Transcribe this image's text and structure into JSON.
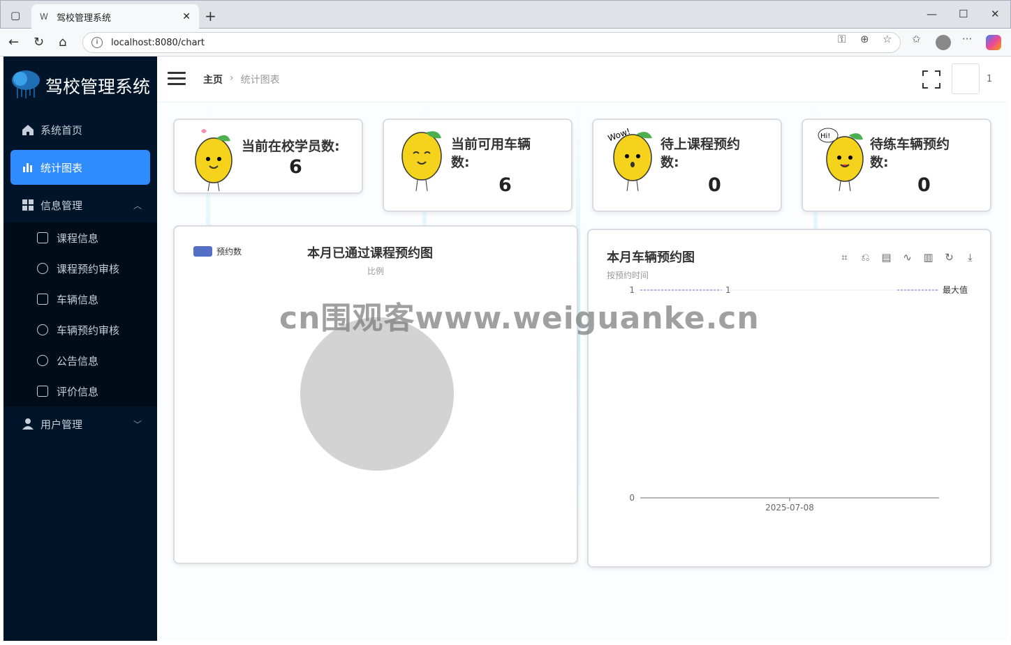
{
  "browser": {
    "tab_title": "驾校管理系统",
    "tab_favicon": "W",
    "url": "localhost:8080/chart"
  },
  "sidebar": {
    "brand": "驾校管理系统",
    "items": [
      {
        "label": "系统首页"
      },
      {
        "label": "统计图表"
      },
      {
        "label": "信息管理"
      },
      {
        "label": "用户管理"
      }
    ],
    "sub_items": [
      {
        "label": "课程信息"
      },
      {
        "label": "课程预约审核"
      },
      {
        "label": "车辆信息"
      },
      {
        "label": "车辆预约审核"
      },
      {
        "label": "公告信息"
      },
      {
        "label": "评价信息"
      }
    ]
  },
  "header": {
    "breadcrumb_home": "主页",
    "breadcrumb_current": "统计图表",
    "user_count": "1"
  },
  "cards": [
    {
      "label": "当前在校学员数:",
      "value": "6"
    },
    {
      "label": "当前可用车辆数:",
      "value": "6"
    },
    {
      "label": "待上课程预约数:",
      "value": "0"
    },
    {
      "label": "待练车辆预约数:",
      "value": "0"
    }
  ],
  "chart_data": [
    {
      "type": "pie",
      "title": "本月已通过课程预约图",
      "subtitle": "比例",
      "legend": [
        "预约数"
      ],
      "values": []
    },
    {
      "type": "line",
      "title": "本月车辆预约图",
      "subtitle": "按预约时间",
      "categories": [
        "2025-07-08"
      ],
      "y_ticks": [
        "1",
        "0"
      ],
      "markline_label": "最大值",
      "markline_value": "1"
    }
  ],
  "watermark": "cn围观客www.weiguanke.cn",
  "colors": {
    "sidebar": "#001529",
    "active": "#2f8cff",
    "series": "#5470c6"
  }
}
